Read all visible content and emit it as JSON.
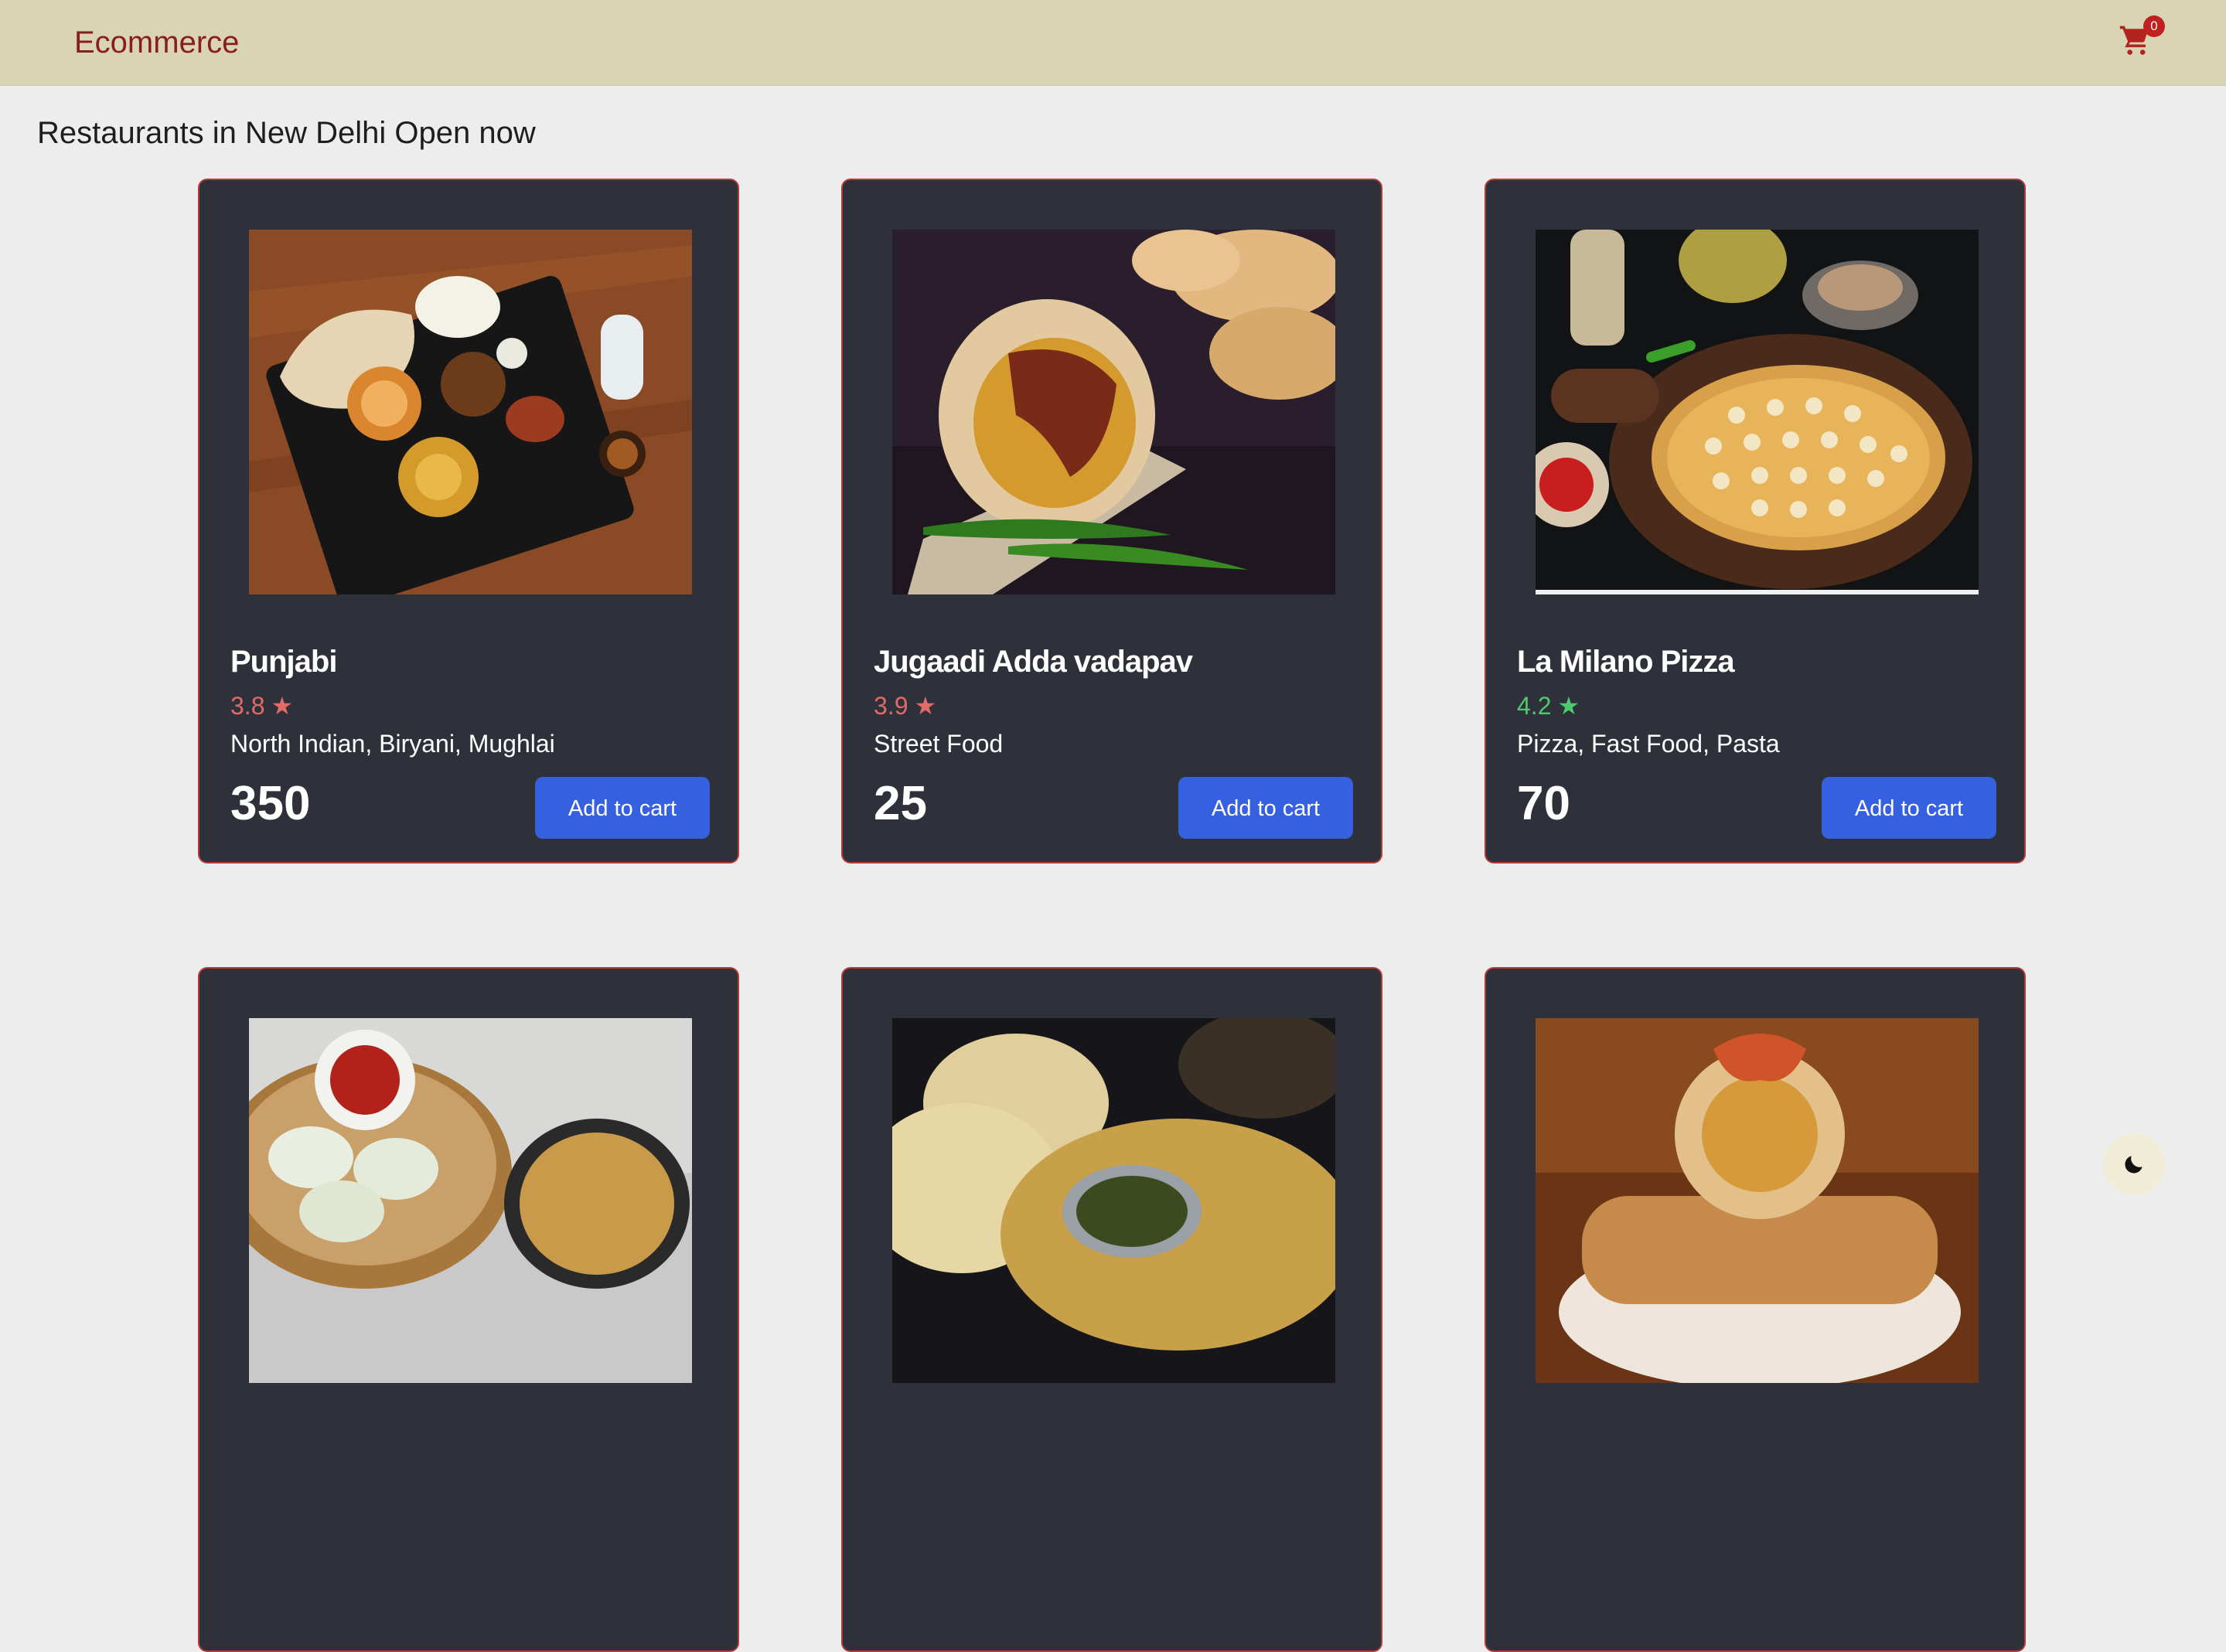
{
  "header": {
    "brand": "Ecommerce",
    "cart_count": "0",
    "cart_icon": "shopping-cart-icon"
  },
  "heading": "Restaurants in New Delhi Open now",
  "colors": {
    "accent_button": "#3560e0",
    "rating_red": "#e36a6a",
    "rating_green": "#4ec96f",
    "card_bg": "#2f313a",
    "header_bg": "#d9d4b4",
    "brand_color": "#8a1d1d"
  },
  "restaurants": [
    {
      "name": "Punjabi",
      "rating": "3.8",
      "rating_color": "#e36a6a",
      "cuisines": "North Indian, Biryani, Mughlai",
      "price": "350",
      "button": "Add to cart",
      "image": "thali-platter-image"
    },
    {
      "name": "Jugaadi Adda vadapav",
      "rating": "3.9",
      "rating_color": "#e36a6a",
      "cuisines": "Street Food",
      "price": "25",
      "button": "Add to cart",
      "image": "vadapav-image"
    },
    {
      "name": "La Milano Pizza",
      "rating": "4.2",
      "rating_color": "#4ec96f",
      "cuisines": "Pizza, Fast Food, Pasta",
      "price": "70",
      "button": "Add to cart",
      "image": "pizza-image"
    },
    {
      "image": "momos-noodles-image"
    },
    {
      "image": "naan-curry-image"
    },
    {
      "image": "wrap-roll-image"
    }
  ],
  "theme_toggle_icon": "moon-icon"
}
